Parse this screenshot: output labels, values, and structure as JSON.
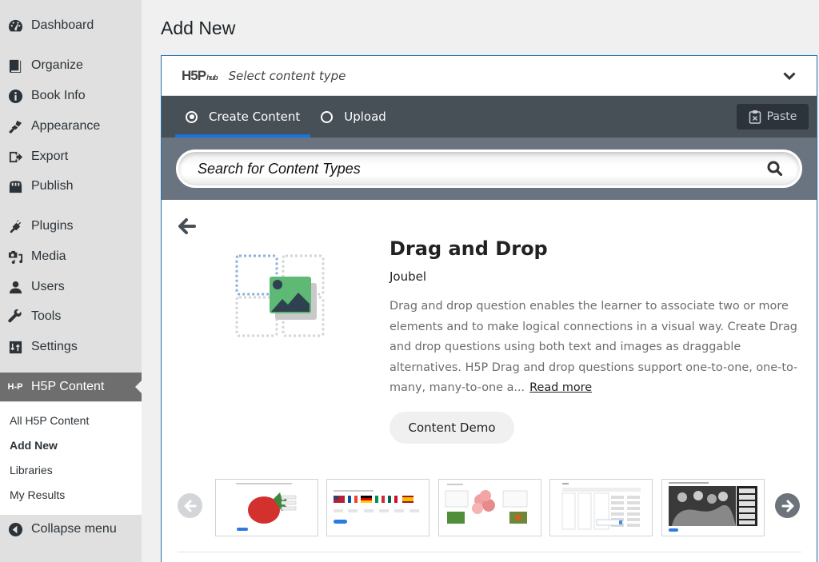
{
  "sidebar": {
    "items": [
      {
        "label": "Dashboard",
        "icon": "dashboard-icon"
      },
      {
        "label": "Organize",
        "icon": "book-icon"
      },
      {
        "label": "Book Info",
        "icon": "info-icon"
      },
      {
        "label": "Appearance",
        "icon": "paintbrush-icon"
      },
      {
        "label": "Export",
        "icon": "export-icon"
      },
      {
        "label": "Publish",
        "icon": "store-icon"
      },
      {
        "label": "Plugins",
        "icon": "plug-icon"
      },
      {
        "label": "Media",
        "icon": "media-icon"
      },
      {
        "label": "Users",
        "icon": "user-icon"
      },
      {
        "label": "Tools",
        "icon": "wrench-icon"
      },
      {
        "label": "Settings",
        "icon": "settings-icon"
      },
      {
        "label": "H5P Content",
        "icon": "h5p-icon",
        "icon_text": "H-P",
        "active": true
      }
    ],
    "submenu": [
      {
        "label": "All H5P Content"
      },
      {
        "label": "Add New",
        "current": true
      },
      {
        "label": "Libraries"
      },
      {
        "label": "My Results"
      }
    ],
    "collapse_label": "Collapse menu"
  },
  "page": {
    "title": "Add New"
  },
  "hub": {
    "logo_main": "H5P",
    "logo_sub": "hub",
    "select_label": "Select content type",
    "tabs": [
      {
        "label": "Create Content",
        "selected": true
      },
      {
        "label": "Upload",
        "selected": false
      }
    ],
    "paste_label": "Paste",
    "search_placeholder": "Search for Content Types",
    "accent_color": "#1a73d9"
  },
  "content_type": {
    "title": "Drag and Drop",
    "owner": "Joubel",
    "description": "Drag and drop question enables the learner to associate two or more elements and to make logical connections in a visual way. Create Drag and drop questions using both text and images as draggable alternatives. H5P Drag and drop questions support one-to-one, one-to-many, many-to-one a...",
    "read_more": "Read more",
    "demo_label": "Content Demo",
    "screenshots": [
      {
        "name": "strawberry-screenshot"
      },
      {
        "name": "flags-screenshot"
      },
      {
        "name": "flowers-screenshot"
      },
      {
        "name": "table-screenshot"
      },
      {
        "name": "photo-screenshot"
      }
    ]
  }
}
